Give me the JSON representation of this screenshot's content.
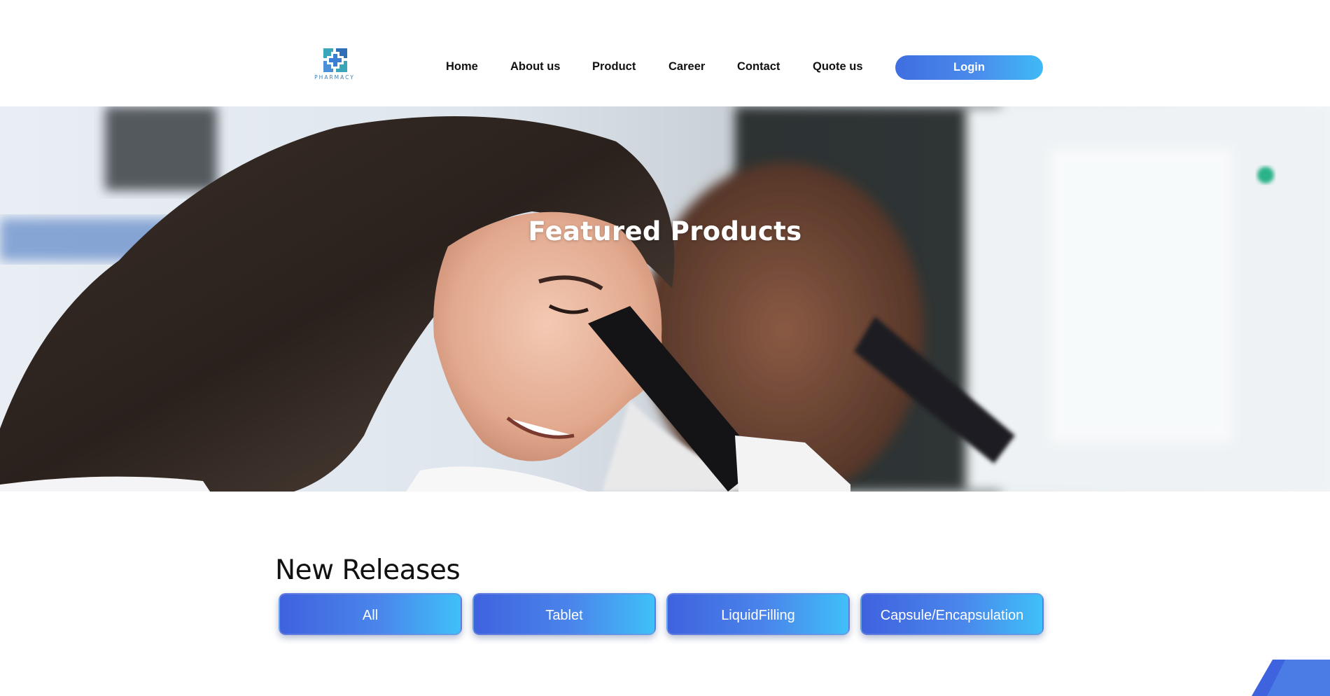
{
  "header": {
    "logo_text": "PHARMACY",
    "nav": [
      {
        "label": "Home"
      },
      {
        "label": "About us"
      },
      {
        "label": "Product"
      },
      {
        "label": "Career"
      },
      {
        "label": "Contact"
      },
      {
        "label": "Quote us"
      }
    ],
    "login_label": "Login"
  },
  "hero": {
    "title": "Featured Products"
  },
  "releases": {
    "title": "New Releases",
    "filters": [
      {
        "label": "All"
      },
      {
        "label": "Tablet"
      },
      {
        "label": "LiquidFilling"
      },
      {
        "label": "Capsule/Encapsulation"
      }
    ]
  },
  "colors": {
    "accent_start": "#3f62df",
    "accent_end": "#3fc0f8",
    "logo_teal": "#3aa6b9",
    "logo_blue": "#3b7fd4"
  },
  "icons": {
    "logo": "medical-cross-logo-icon"
  }
}
